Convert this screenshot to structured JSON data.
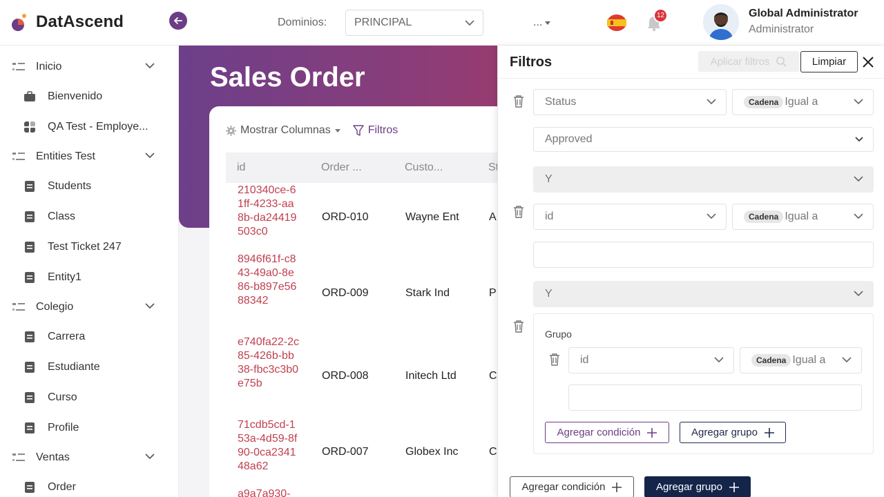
{
  "app": {
    "name": "DatAscend"
  },
  "header": {
    "domains_label": "Dominios:",
    "domain_selected": "PRINCIPAL",
    "more_menu": "...",
    "notification_count": "12",
    "user_name": "Global Administrator",
    "user_role": "Administrator"
  },
  "sidebar": {
    "groups": [
      {
        "label": "Inicio",
        "items": [
          "Bienvenido",
          "QA Test - Employe..."
        ]
      },
      {
        "label": "Entities Test",
        "items": [
          "Students",
          "Class",
          "Test Ticket 247",
          "Entity1"
        ]
      },
      {
        "label": "Colegio",
        "items": [
          "Carrera",
          "Estudiante",
          "Curso",
          "Profile"
        ]
      },
      {
        "label": "Ventas",
        "items": [
          "Order"
        ]
      }
    ]
  },
  "main": {
    "title": "Sales Order",
    "toolbar": {
      "columns": "Mostrar Columnas",
      "filters": "Filtros"
    },
    "columns": [
      "id",
      "Order ...",
      "Custo...",
      "St"
    ],
    "rows": [
      {
        "id": "210340ce-61ff-4233-aa8b-da24419503c0",
        "order": "ORD-010",
        "customer": "Wayne Ent",
        "status": "A"
      },
      {
        "id": "8946f61f-c843-49a0-8e86-b897e5688342",
        "order": "ORD-009",
        "customer": "Stark Ind",
        "status": "P"
      },
      {
        "id": "e740fa22-2c85-426b-bb38-fbc3c3b0e75b",
        "order": "ORD-008",
        "customer": "Initech Ltd",
        "status": "C"
      },
      {
        "id": "71cdb5cd-153a-4d59-8f90-0ca234148a62",
        "order": "ORD-007",
        "customer": "Globex Inc",
        "status": "C"
      },
      {
        "id": "a9a7a930-",
        "order": "",
        "customer": "",
        "status": ""
      }
    ]
  },
  "filters": {
    "title": "Filtros",
    "apply": "Aplicar filtros",
    "clear": "Limpiar",
    "condition1": {
      "field": "Status",
      "type": "Cadena",
      "operator": "Igual a",
      "value": "Approved"
    },
    "join1": "Y",
    "condition2": {
      "field": "id",
      "type": "Cadena",
      "operator": "Igual a",
      "value": ""
    },
    "join2": "Y",
    "group": {
      "label": "Grupo",
      "condition": {
        "field": "id",
        "type": "Cadena",
        "operator": "Igual a",
        "value": ""
      },
      "add_condition": "Agregar condición",
      "add_group": "Agregar grupo"
    },
    "add_condition": "Agregar condición",
    "add_group": "Agregar grupo"
  }
}
